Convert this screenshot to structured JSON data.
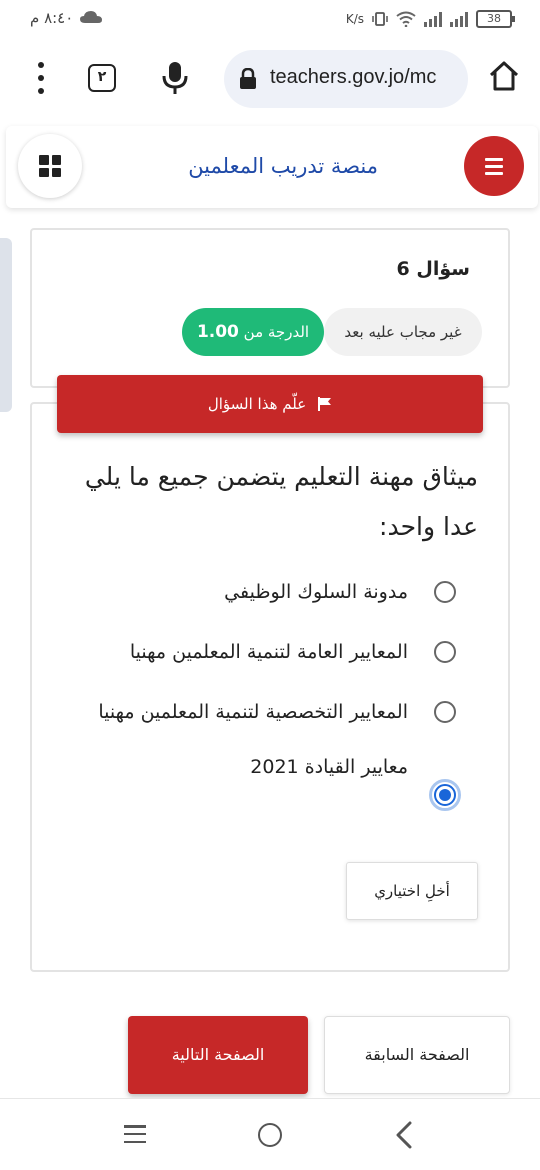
{
  "status_bar": {
    "time": "٨:٤٠ م",
    "net_speed": "K/s",
    "battery": "38"
  },
  "browser": {
    "tab_count": "٢",
    "url": "teachers.gov.jo/mc"
  },
  "header": {
    "title": "منصة تدريب المعلمين"
  },
  "question": {
    "number_label": "سؤال 6",
    "status": "غير مجاب عليه بعد",
    "grade_prefix": "الدرجة من",
    "grade_value": "1.00",
    "flag_label": "علّم هذا السؤال",
    "text": "ميثاق مهنة التعليم يتضمن جميع ما يلي عدا واحد:",
    "options": [
      {
        "label": "مدونة السلوك الوظيفي",
        "checked": false
      },
      {
        "label": "المعايير العامة لتنمية المعلمين مهنيا",
        "checked": false
      },
      {
        "label": "المعايير التخصصية لتنمية المعلمين مهنيا",
        "checked": false
      },
      {
        "label": "معايير القيادة 2021",
        "checked": true
      }
    ],
    "clear_label": "أخلِ اختياري"
  },
  "navigation": {
    "prev_label": "الصفحة السابقة",
    "next_label": "الصفحة التالية"
  },
  "colors": {
    "accent_red": "#c62828",
    "grade_green": "#1fba78",
    "title_blue": "#1f4aa8",
    "radio_blue": "#1a66d9"
  }
}
